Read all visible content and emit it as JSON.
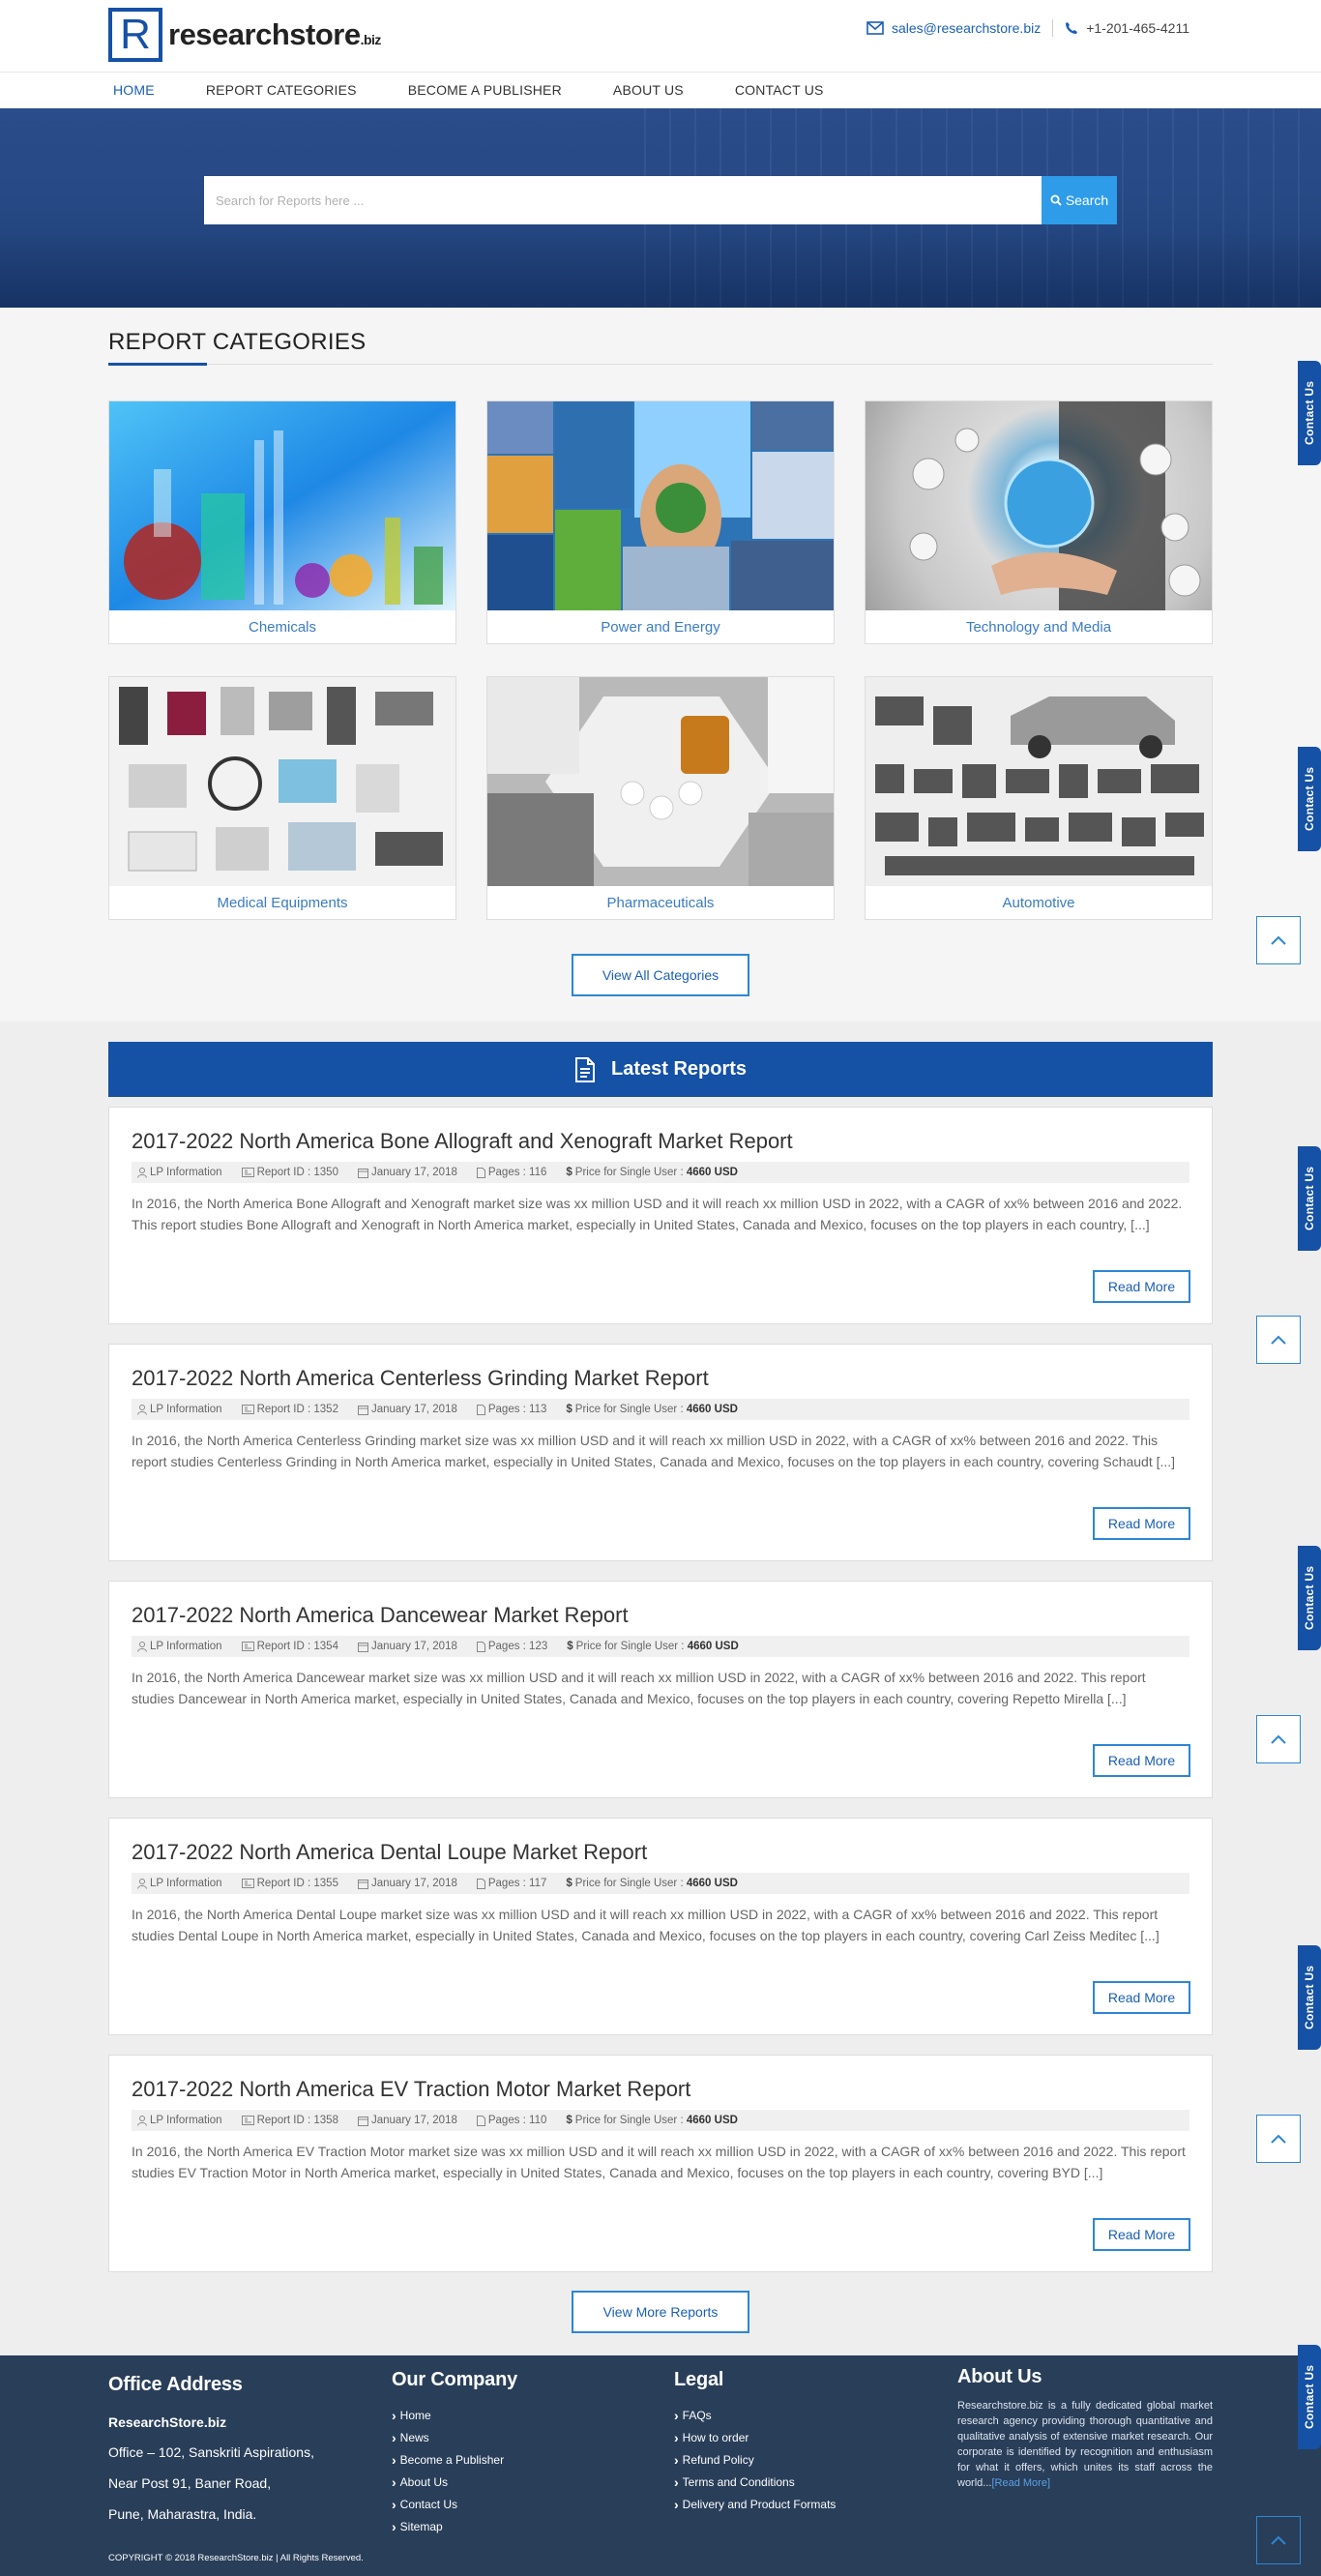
{
  "header": {
    "logo_letter": "R",
    "logo_name": "researchstore",
    "logo_tld": ".biz",
    "email": "sales@researchstore.biz",
    "phone": "+1-201-465-4211"
  },
  "nav": {
    "items": [
      {
        "label": "HOME",
        "active": true
      },
      {
        "label": "REPORT CATEGORIES"
      },
      {
        "label": "BECOME A PUBLISHER"
      },
      {
        "label": "ABOUT US"
      },
      {
        "label": "CONTACT US"
      }
    ]
  },
  "search": {
    "placeholder": "Search for Reports here ...",
    "button_label": "Search"
  },
  "categories": {
    "title": "REPORT CATEGORIES",
    "items": [
      {
        "label": "Chemicals"
      },
      {
        "label": "Power and Energy"
      },
      {
        "label": "Technology and Media"
      },
      {
        "label": "Medical Equipments"
      },
      {
        "label": "Pharmaceuticals"
      },
      {
        "label": "Automotive"
      }
    ],
    "view_all_label": "View All Categories"
  },
  "reports": {
    "title": "Latest Reports",
    "read_more_label": "Read More",
    "view_more_label": "View More Reports",
    "price_label": "Price for Single User :",
    "items": [
      {
        "title": "2017-2022 North America Bone Allograft and Xenograft Market Report",
        "publisher": "LP Information",
        "report_id": "Report ID : 1350",
        "date": "January 17, 2018",
        "pages": "Pages : 116",
        "price": "4660 USD",
        "desc": "In 2016, the North America Bone Allograft and Xenograft market size was xx million USD and it will reach xx million USD in 2022, with a CAGR of xx% between 2016 and 2022. This report studies Bone Allograft and Xenograft in North America market, especially in United States, Canada and Mexico, focuses on the top players in each country, [...]"
      },
      {
        "title": "2017-2022 North America Centerless Grinding Market Report",
        "publisher": "LP Information",
        "report_id": "Report ID : 1352",
        "date": "January 17, 2018",
        "pages": "Pages : 113",
        "price": "4660 USD",
        "desc": "In 2016, the North America Centerless Grinding market size was xx million USD and it will reach xx million USD in 2022, with a CAGR of xx% between 2016 and 2022. This report studies Centerless Grinding in North America market, especially in United States, Canada and Mexico, focuses on the top players in each country, covering Schaudt [...]"
      },
      {
        "title": "2017-2022 North America Dancewear Market Report",
        "publisher": "LP Information",
        "report_id": "Report ID : 1354",
        "date": "January 17, 2018",
        "pages": "Pages : 123",
        "price": "4660 USD",
        "desc": "In 2016, the North America Dancewear market size was xx million USD and it will reach xx million USD in 2022, with a CAGR of xx% between 2016 and 2022. This report studies Dancewear in North America market, especially in United States, Canada and Mexico, focuses on the top players in each country, covering Repetto Mirella [...]"
      },
      {
        "title": "2017-2022 North America Dental Loupe Market Report",
        "publisher": "LP Information",
        "report_id": "Report ID : 1355",
        "date": "January 17, 2018",
        "pages": "Pages : 117",
        "price": "4660 USD",
        "desc": "In 2016, the North America Dental Loupe market size was xx million USD and it will reach xx million USD in 2022, with a CAGR of xx% between 2016 and 2022. This report studies Dental Loupe in North America market, especially in United States, Canada and Mexico, focuses on the top players in each country, covering Carl Zeiss Meditec [...]"
      },
      {
        "title": "2017-2022 North America EV Traction Motor Market Report",
        "publisher": "LP Information",
        "report_id": "Report ID : 1358",
        "date": "January 17, 2018",
        "pages": "Pages : 110",
        "price": "4660 USD",
        "desc": "In 2016, the North America EV Traction Motor market size was xx million USD and it will reach xx million USD in 2022, with a CAGR of xx% between 2016 and 2022. This report studies EV Traction Motor in North America market, especially in United States, Canada and Mexico, focuses on the top players in each country, covering BYD [...]"
      }
    ]
  },
  "footer": {
    "office": {
      "title": "Office Address",
      "company": "ResearchStore.biz",
      "line1": "Office – 102, Sanskriti Aspirations,",
      "line2": "Near Post 91, Baner Road,",
      "line3": "Pune, Maharastra, India."
    },
    "company": {
      "title": "Our Company",
      "links": [
        "Home",
        "News",
        "Become a Publisher",
        "About Us",
        "Contact Us",
        "Sitemap"
      ]
    },
    "legal": {
      "title": "Legal",
      "links": [
        "FAQs",
        "How to order",
        "Refund Policy",
        "Terms and Conditions",
        "Delivery and Product Formats"
      ]
    },
    "about": {
      "title": "About Us",
      "text": "Researchstore.biz is a fully dedicated global market research agency providing thorough quantitative and qualitative analysis of extensive market research. Our corporate is identified by recognition and enthusiasm for what it offers, which unites its staff across the world...",
      "more": "[Read More]"
    },
    "copyright": "COPYRIGHT © 2018 ResearchStore.biz | All Rights Reserved."
  },
  "floating": {
    "contact_tab_label": "Contact Us"
  },
  "colors": {
    "brand_blue": "#1551a5",
    "accent_blue": "#2e9ce9",
    "footer_bg": "#293e59"
  }
}
